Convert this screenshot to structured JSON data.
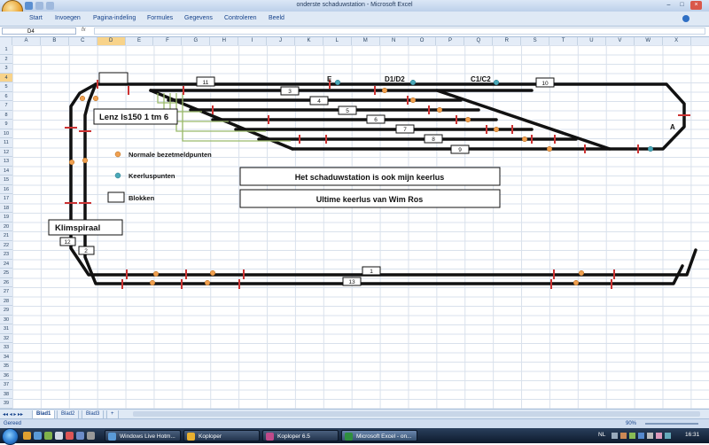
{
  "window": {
    "title": "onderste schaduwstation - Microsoft Excel",
    "controls": [
      "–",
      "□",
      "×"
    ]
  },
  "ribbon": {
    "tabs": [
      "Start",
      "Invoegen",
      "Pagina-indeling",
      "Formules",
      "Gegevens",
      "Controleren",
      "Beeld"
    ]
  },
  "formula_bar": {
    "name_box": "D4",
    "fx": "fx",
    "content": ""
  },
  "columns": [
    "A",
    "B",
    "C",
    "D",
    "E",
    "F",
    "G",
    "H",
    "I",
    "J",
    "K",
    "L",
    "M",
    "N",
    "O",
    "P",
    "Q",
    "R",
    "S",
    "T",
    "U",
    "V",
    "W",
    "X"
  ],
  "selected_column": "D",
  "rows": [
    "1",
    "2",
    "3",
    "4",
    "5",
    "6",
    "7",
    "8",
    "9",
    "10",
    "11",
    "12",
    "13",
    "14",
    "15",
    "16",
    "17",
    "18",
    "19",
    "20",
    "21",
    "22",
    "23",
    "24",
    "25",
    "26",
    "27",
    "28",
    "29",
    "30",
    "31",
    "32",
    "33",
    "34",
    "35",
    "36",
    "37",
    "38",
    "39"
  ],
  "selected_row": "4",
  "drawing": {
    "block_numbers": [
      "11",
      "3",
      "4",
      "5",
      "6",
      "7",
      "8",
      "9",
      "10",
      "1",
      "13",
      "12",
      "2"
    ],
    "point_labels": {
      "e": "E",
      "d1d2": "D1/D2",
      "c1c2": "C1/C2",
      "a": "A"
    },
    "lenz_box": "Lenz ls150 1 tm 6",
    "klimspiraal": "Klimspiraal",
    "banner_1": "Het schaduwstation is ook mijn keerlus",
    "banner_2": "Ultime keerlus van Wim Ros",
    "legend": {
      "normal": "Normale bezetmeldpunten",
      "reverse": "Keerluspunten",
      "blocks": "Blokken"
    },
    "colors": {
      "track": "#111111",
      "separator": "#cc3333",
      "normal_point": "#f0a050",
      "reverse_point": "#4aa8b8",
      "arrows": "#9aba6a"
    }
  },
  "sheets": [
    "Blad1",
    "Blad2",
    "Blad3"
  ],
  "active_sheet": "Blad1",
  "status": {
    "left": "Gereed",
    "zoom": "90%"
  },
  "taskbar": {
    "items": [
      "Windows Live Hotm...",
      "Koploper",
      "Koploper 6.5",
      "Microsoft Excel - on..."
    ],
    "active_item": "Microsoft Excel - on...",
    "language": "NL",
    "clock": "16:31"
  }
}
